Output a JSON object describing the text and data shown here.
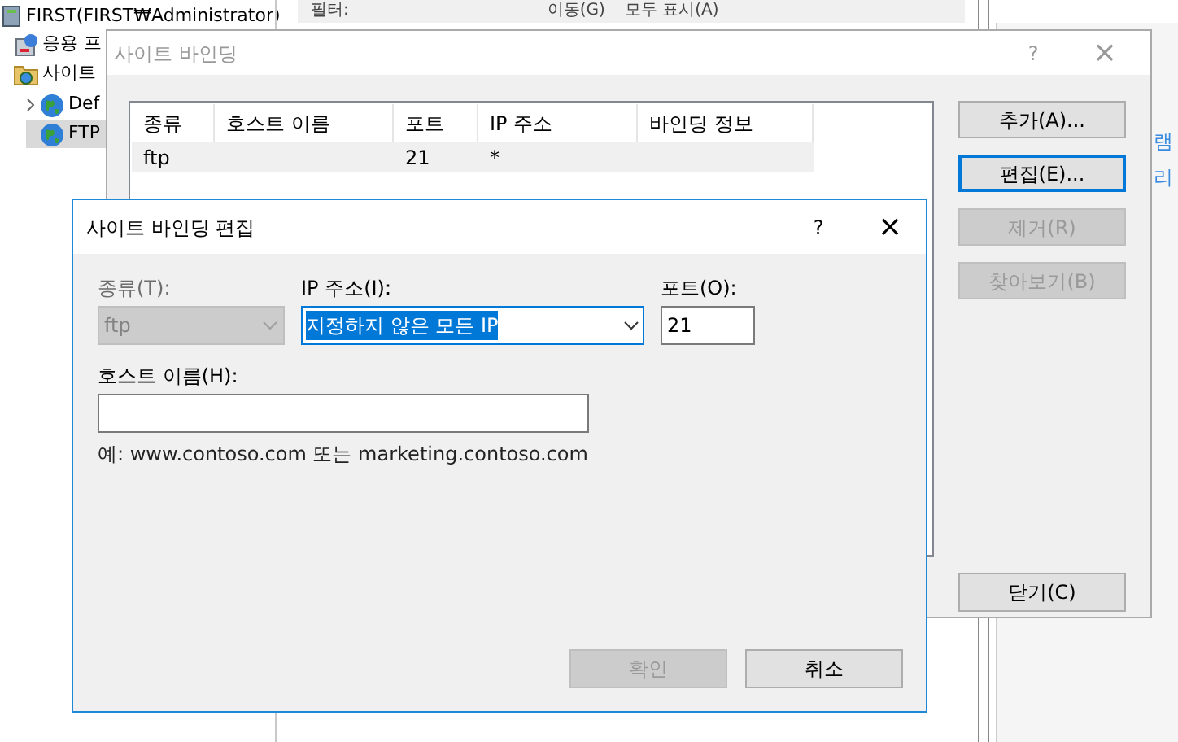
{
  "background_window": {
    "toolbar": {
      "filter_label": "필터:",
      "go_button": "이동(G)",
      "show_all_button": "모두 표시(A)"
    },
    "tree": [
      {
        "label": "FIRST(FIRST₩Administrator)",
        "selected": false,
        "kind": "server",
        "children": [
          {
            "label": "응용 프",
            "selected": false,
            "kind": "pool"
          },
          {
            "label": "사이트",
            "selected": false,
            "kind": "sites",
            "children": [
              {
                "label": "Def",
                "selected": false,
                "kind": "site",
                "expandable": true
              },
              {
                "label": "FTP",
                "selected": true,
                "kind": "site",
                "expandable": false
              }
            ]
          }
        ]
      }
    ],
    "action_links": [
      "램",
      "리"
    ]
  },
  "bindings_dialog": {
    "title": "사이트 바인딩",
    "columns": [
      "종류",
      "호스트 이름",
      "포트",
      "IP 주소",
      "바인딩 정보"
    ],
    "rows": [
      {
        "cells": [
          "ftp",
          "",
          "21",
          "*",
          ""
        ],
        "selected": true
      }
    ],
    "buttons": [
      {
        "label": "추가(A)...",
        "disabled": false,
        "focused": false
      },
      {
        "label": "편집(E)...",
        "disabled": false,
        "focused": true
      },
      {
        "label": "제거(R)",
        "disabled": true,
        "focused": false
      },
      {
        "label": "찾아보기(B)",
        "disabled": true,
        "focused": false
      }
    ],
    "close_button": "닫기(C)",
    "help": "?",
    "close": "×"
  },
  "edit_dialog": {
    "title": "사이트 바인딩 편집",
    "help": "?",
    "close": "×",
    "type": {
      "label": "종류(T):",
      "value": "ftp",
      "disabled": true
    },
    "ip": {
      "label": "IP 주소(I):",
      "value": "지정하지 않은 모든 IP",
      "disabled": false
    },
    "port": {
      "label": "포트(O):",
      "value": "21"
    },
    "host": {
      "label": "호스트 이름(H):"
    },
    "example": "예: www.contoso.com 또는 marketing.contoso.com",
    "buttons": [
      {
        "label": "확인",
        "disabled": true
      },
      {
        "label": "취소",
        "disabled": false
      }
    ]
  }
}
